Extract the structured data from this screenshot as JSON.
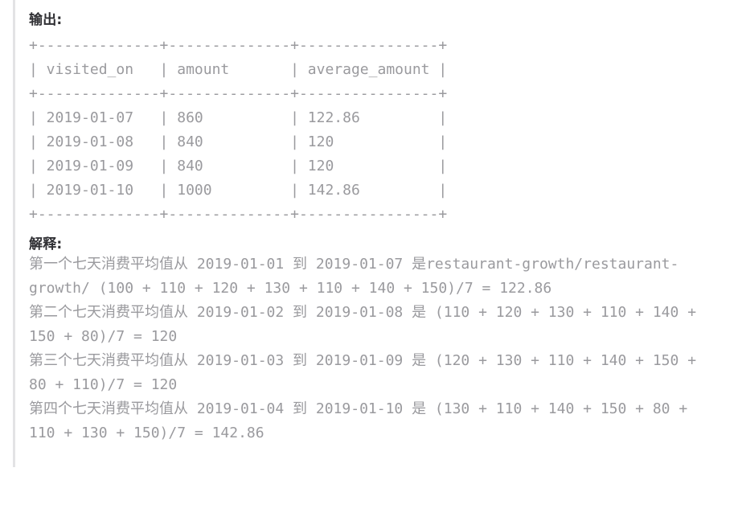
{
  "document": {
    "clipped_top_row": "|              |              |                |",
    "output": {
      "heading": "输出:",
      "table": {
        "rule": "+--------------+--------------+----------------+",
        "columns": [
          "visited_on",
          "amount",
          "average_amount"
        ],
        "header_row": "| visited_on   | amount       | average_amount |",
        "rows": [
          {
            "visited_on": "2019-01-07",
            "amount": "860",
            "average_amount": "122.86",
            "text": "| 2019-01-07   | 860          | 122.86         |"
          },
          {
            "visited_on": "2019-01-08",
            "amount": "840",
            "average_amount": "120",
            "text": "| 2019-01-08   | 840          | 120            |"
          },
          {
            "visited_on": "2019-01-09",
            "amount": "840",
            "average_amount": "120",
            "text": "| 2019-01-09   | 840          | 120            |"
          },
          {
            "visited_on": "2019-01-10",
            "amount": "1000",
            "average_amount": "142.86",
            "text": "| 2019-01-10   | 1000         | 142.86         |"
          }
        ],
        "full_text": "+--------------+--------------+----------------+\n| visited_on   | amount       | average_amount |\n+--------------+--------------+----------------+\n| 2019-01-07   | 860          | 122.86         |\n| 2019-01-08   | 840          | 120            |\n| 2019-01-09   | 840          | 120            |\n| 2019-01-10   | 1000         | 142.86         |\n+--------------+--------------+----------------+"
      }
    },
    "explanation": {
      "heading": "解释:",
      "lines": [
        "第一个七天消费平均值从 2019-01-01 到 2019-01-07 是restaurant-growth/restaurant-growth/ (100 + 110 + 120 + 130 + 110 + 140 + 150)/7 = 122.86",
        "第二个七天消费平均值从 2019-01-02 到 2019-01-08 是 (110 + 120 + 130 + 110 + 140 + 150 + 80)/7 = 120",
        "第三个七天消费平均值从 2019-01-03 到 2019-01-09 是 (120 + 130 + 110 + 140 + 150 + 80 + 110)/7 = 120",
        "第四个七天消费平均值从 2019-01-04 到 2019-01-10 是 (130 + 110 + 140 + 150 + 80 + 110 + 130 + 150)/7 = 142.86"
      ]
    }
  },
  "colors": {
    "page_background": "#ffffff",
    "heading_text": "#2f2f33",
    "body_text": "#9a9a9e",
    "left_rule": "#e3e3e5"
  }
}
